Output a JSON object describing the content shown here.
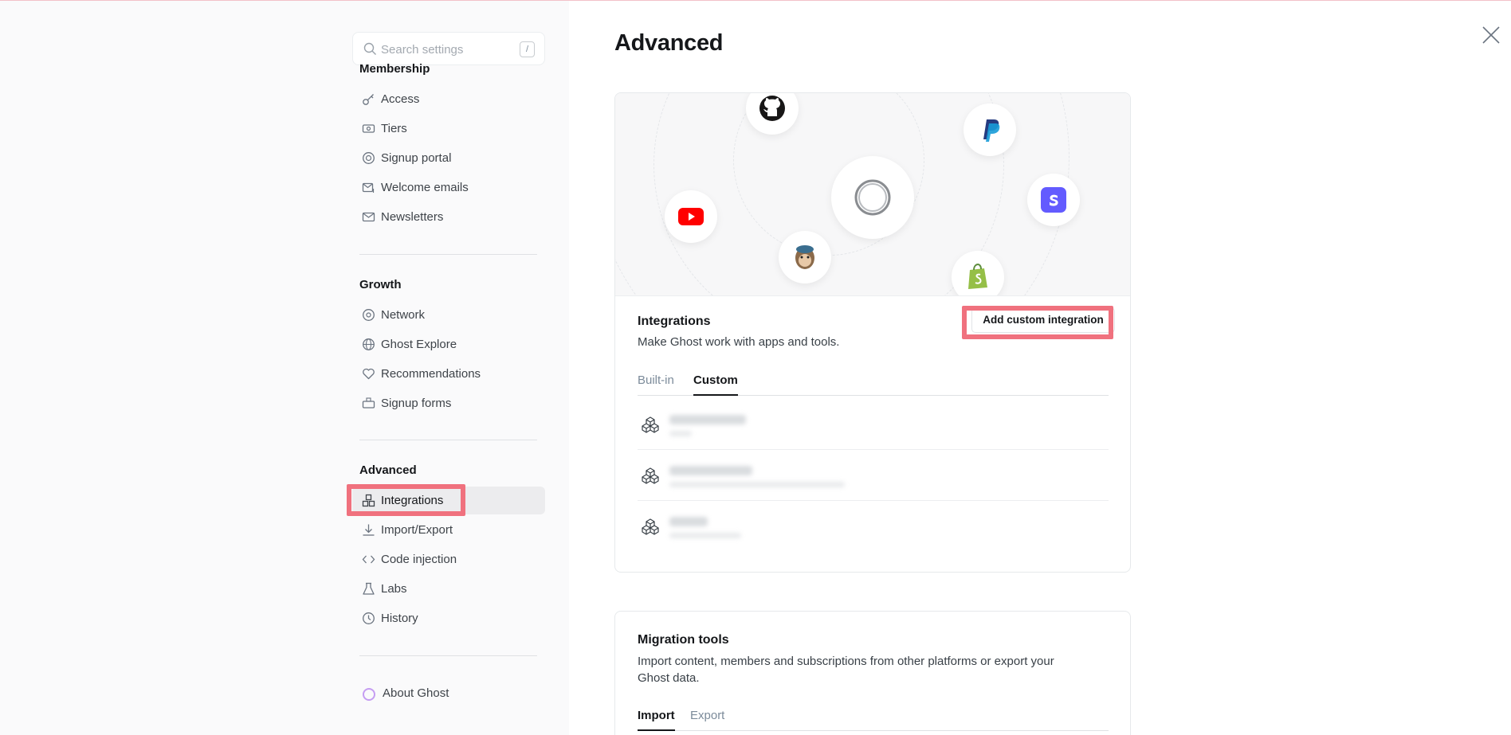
{
  "search": {
    "placeholder": "Search settings",
    "shortcut": "/"
  },
  "sidebar": {
    "membership": {
      "title": "Membership",
      "items": [
        {
          "label": "Access",
          "icon": "key-icon"
        },
        {
          "label": "Tiers",
          "icon": "ticket-icon"
        },
        {
          "label": "Signup portal",
          "icon": "portal-icon"
        },
        {
          "label": "Welcome emails",
          "icon": "mail-plus-icon"
        },
        {
          "label": "Newsletters",
          "icon": "envelope-icon"
        }
      ]
    },
    "growth": {
      "title": "Growth",
      "items": [
        {
          "label": "Network",
          "icon": "network-icon"
        },
        {
          "label": "Ghost Explore",
          "icon": "globe-icon"
        },
        {
          "label": "Recommendations",
          "icon": "heart-icon"
        },
        {
          "label": "Signup forms",
          "icon": "form-icon"
        }
      ]
    },
    "advanced": {
      "title": "Advanced",
      "items": [
        {
          "label": "Integrations",
          "icon": "integrations-icon",
          "active": true
        },
        {
          "label": "Import/Export",
          "icon": "download-icon"
        },
        {
          "label": "Code injection",
          "icon": "code-icon"
        },
        {
          "label": "Labs",
          "icon": "flask-icon"
        },
        {
          "label": "History",
          "icon": "history-icon"
        }
      ]
    },
    "about": {
      "label": "About Ghost",
      "icon": "ghost-ring-icon"
    }
  },
  "main": {
    "title": "Advanced",
    "integrations": {
      "title": "Integrations",
      "description": "Make Ghost work with apps and tools.",
      "add_button": "Add custom integration",
      "tabs": [
        {
          "label": "Built-in",
          "active": false
        },
        {
          "label": "Custom",
          "active": true
        }
      ],
      "logos": [
        "ghost-logo-icon",
        "github-icon",
        "paypal-icon",
        "stripe-icon",
        "youtube-icon",
        "mailchimp-icon",
        "shopify-icon"
      ]
    },
    "migration": {
      "title": "Migration tools",
      "description": "Import content, members and subscriptions from other platforms or export your Ghost data.",
      "tabs": [
        {
          "label": "Import",
          "active": true
        },
        {
          "label": "Export",
          "active": false
        }
      ]
    }
  },
  "colors": {
    "highlight": "#f0717e",
    "sidebar_bg": "#fafafb",
    "active_item_bg": "#ececee"
  }
}
